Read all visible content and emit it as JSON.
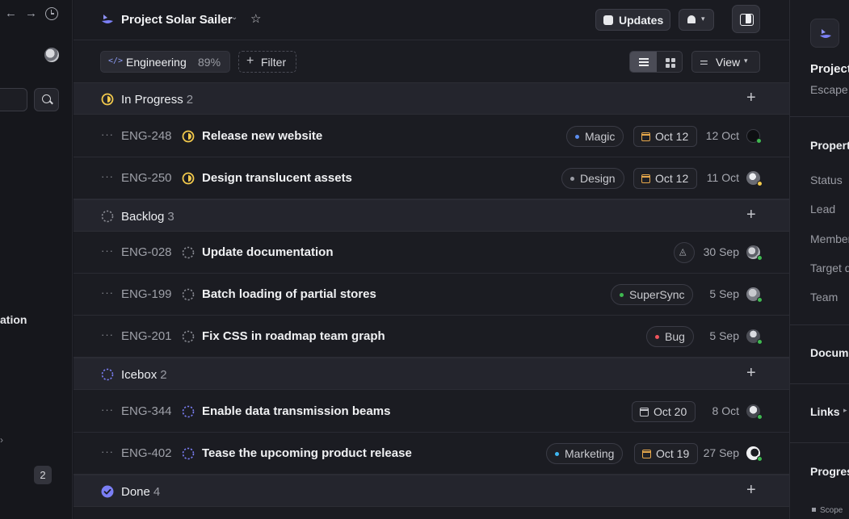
{
  "nav": {
    "back_glyph": "←",
    "forward_glyph": "→",
    "partial_label": "ation",
    "badge_count": "2"
  },
  "header": {
    "project_title": "Project Solar Sailer",
    "updates_label": "Updates",
    "accent_color": "#7b7ff5"
  },
  "filterbar": {
    "team_chip_label": "Engineering",
    "team_chip_percent": "89%",
    "filter_label": "Filter",
    "view_label": "View"
  },
  "groups": [
    {
      "label": "In Progress",
      "count": "2",
      "icon": "in-progress-icon"
    },
    {
      "label": "Backlog",
      "count": "3",
      "icon": "backlog-icon"
    },
    {
      "label": "Icebox",
      "count": "2",
      "icon": "icebox-icon"
    },
    {
      "label": "Done",
      "count": "4",
      "icon": "done-icon"
    }
  ],
  "issues": [
    {
      "id": "ENG-248",
      "title": "Release new website",
      "label": "Magic",
      "label_color": "#5b8def",
      "due": "Oct 12",
      "date": "12 Oct"
    },
    {
      "id": "ENG-250",
      "title": "Design translucent assets",
      "label": "Design",
      "label_color": "#9a9ca4",
      "due": "Oct 12",
      "date": "11 Oct"
    },
    {
      "id": "ENG-028",
      "title": "Update documentation",
      "date": "30 Sep"
    },
    {
      "id": "ENG-199",
      "title": "Batch loading of partial stores",
      "label": "SuperSync",
      "label_color": "#3fb950",
      "date": "5 Sep"
    },
    {
      "id": "ENG-201",
      "title": "Fix CSS in roadmap team graph",
      "label": "Bug",
      "label_color": "#f0545c",
      "date": "5 Sep"
    },
    {
      "id": "ENG-344",
      "title": "Enable data transmission beams",
      "due": "Oct 20",
      "date": "8 Oct"
    },
    {
      "id": "ENG-402",
      "title": "Tease the upcoming product release",
      "label": "Marketing",
      "label_color": "#3fb6f0",
      "due": "Oct 19",
      "date": "27 Sep"
    }
  ],
  "right_panel": {
    "title": "Project",
    "subtitle": "Escape",
    "properties_heading": "Properti",
    "properties": [
      "Status",
      "Lead",
      "Member",
      "Target d",
      "Team"
    ],
    "documents_heading": "Docume",
    "links_heading": "Links",
    "progress_heading": "Progres",
    "scope_label": "Scope"
  }
}
